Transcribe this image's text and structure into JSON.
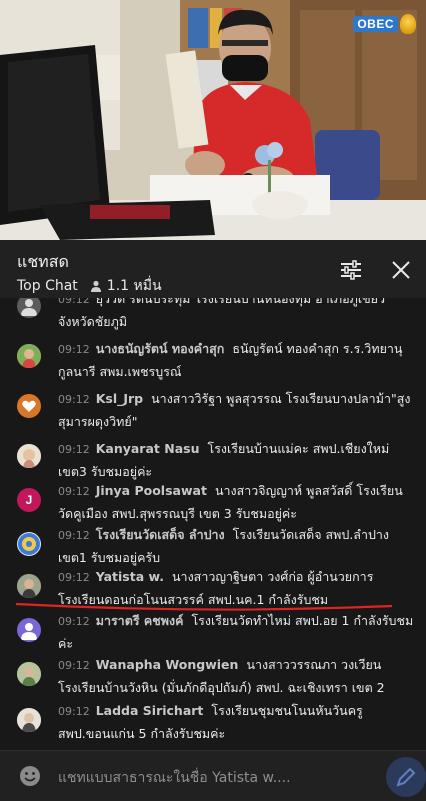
{
  "video": {
    "logo_text": "OBEC",
    "colors": {
      "wall": "#d8d0bf",
      "shirt": "#d62a2a",
      "laptop": "#151515",
      "cabinet": "#7a5636"
    }
  },
  "chat": {
    "title": "แชทสด",
    "mode": "Top Chat",
    "viewers": "1.1 หมื่น",
    "filter_icon": "sliders-icon",
    "close_icon": "close-icon"
  },
  "messages": [
    {
      "time": "09:12",
      "author": "",
      "text": "ยุววดี รัตนประทุม  โรงเรียนบ้านหนองทุ่ม อำเภอภูเขียว จังหวัดชัยภูมิ",
      "avatar": {
        "type": "generic",
        "color": "#5b5b5b"
      }
    },
    {
      "time": "09:12",
      "author": "นางธนัญรัตน์ ทองคำสุก",
      "text": "ธนัญรัตน์ ทองคำสุก ร.ร.วิทยานุกูลนารี สพม.เพชรบูรณ์",
      "avatar": {
        "type": "photo",
        "color": "#c79a44"
      }
    },
    {
      "time": "09:12",
      "author": "Ksl_Jrp",
      "text": "นางสาววิรัฐา พูลสุวรรณ โรงเรียนบางปลาม้า\"สูงสุมารผดุงวิทย์\"",
      "avatar": {
        "type": "heart",
        "color": "#d8772a"
      }
    },
    {
      "time": "09:12",
      "author": "Kanyarat Nasu",
      "text": "โรงเรียนบ้านแม่คะ สพป.เชียงใหม่ เขต3 รับชมอยู่ค่ะ",
      "avatar": {
        "type": "photo",
        "color": "#b9a78a"
      }
    },
    {
      "time": "09:12",
      "author": "Jinya Poolsawat",
      "text": "นางสาวจิญญาห์ พูลสวัสดิ์ โรงเรียนวัดคูเมือง สพป.สุพรรณบุรี เขต 3 รับชมอยู่ค่ะ",
      "avatar": {
        "type": "letter",
        "letter": "J",
        "color": "#c2185b"
      }
    },
    {
      "time": "09:12",
      "author": "โรงเรียนวัดเสด็จ ลำปาง",
      "text": "โรงเรียนวัดเสด็จ สพป.ลำปาง เขต1 รับชมอยู่ครับ",
      "avatar": {
        "type": "emblem",
        "color": "#3a7bd5"
      }
    },
    {
      "time": "09:12",
      "author": "Yatista w.",
      "text": "นางสาวญาฐิษตา วงศ์ก่อ ผู้อำนวยการโรงเรียนดอนก่อโนนสวรรค์ สพป.นค.1 กำลังรับชม",
      "avatar": {
        "type": "photo",
        "color": "#6f7a68"
      }
    },
    {
      "time": "09:12",
      "author": "มาราตรี คชพงค์",
      "text": "โรงเรียนวัดทำไหม่ สพป.อย 1 กำลังรับชมค่ะ",
      "avatar": {
        "type": "generic",
        "color": "#7a67d6"
      }
    },
    {
      "time": "09:12",
      "author": "Wanapha Wongwien",
      "text": "นางสาววรรณภา วงเวียน โรงเรียนบ้านวังหิน (มั่นภักดีอุปถัมภ์) สพป. ฉะเชิงเทรา เขต 2",
      "avatar": {
        "type": "photo",
        "color": "#9aa37b"
      }
    },
    {
      "time": "09:12",
      "author": "Ladda Sirichart",
      "text": "โรงเรียนชุมชนโนนหันวันครู สพป.ขอนแก่น 5 กำลังรับชมค่ะ",
      "avatar": {
        "type": "photo",
        "color": "#c9c4bc"
      }
    }
  ],
  "composer": {
    "placeholder": "แชทแบบสาธารณะในชื่อ Yatista w....",
    "emoji_icon": "smiley-icon",
    "send_icon": "send-icon"
  }
}
